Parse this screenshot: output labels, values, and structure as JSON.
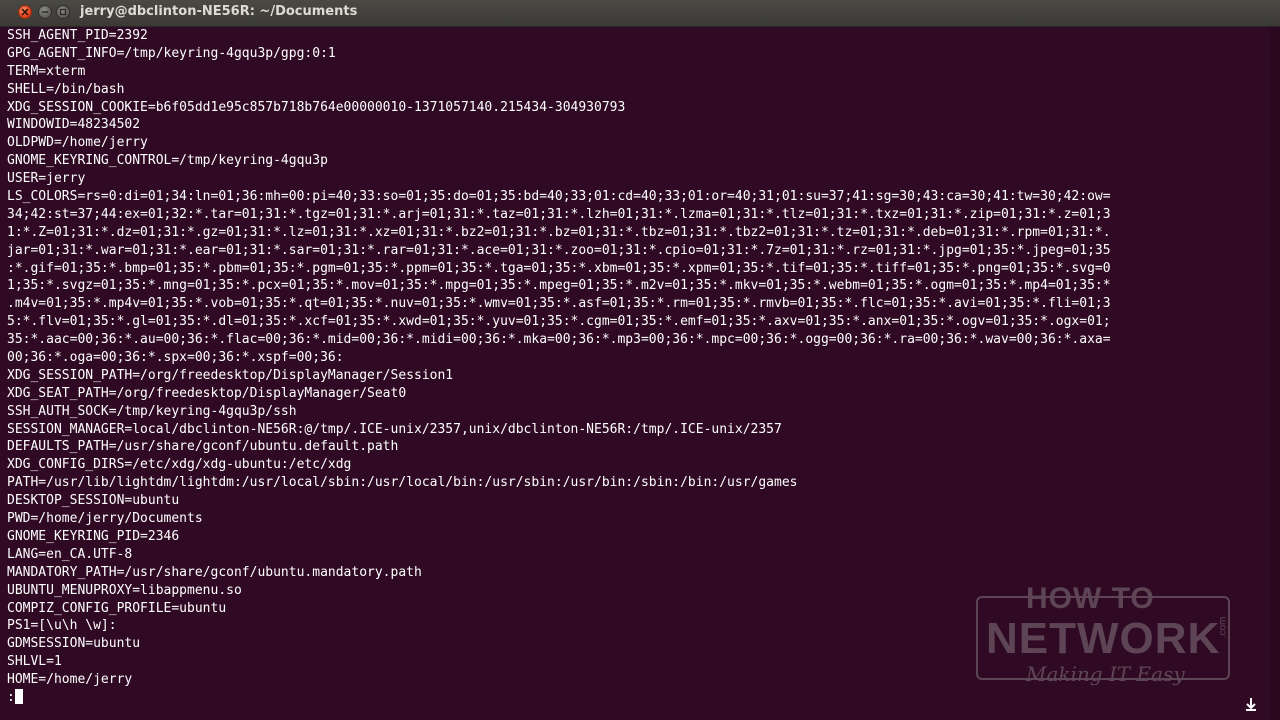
{
  "window": {
    "title": "jerry@dbclinton-NE56R: ~/Documents"
  },
  "terminal": {
    "lines": [
      "SSH_AGENT_PID=2392",
      "GPG_AGENT_INFO=/tmp/keyring-4gqu3p/gpg:0:1",
      "TERM=xterm",
      "SHELL=/bin/bash",
      "XDG_SESSION_COOKIE=b6f05dd1e95c857b718b764e00000010-1371057140.215434-304930793",
      "WINDOWID=48234502",
      "OLDPWD=/home/jerry",
      "GNOME_KEYRING_CONTROL=/tmp/keyring-4gqu3p",
      "USER=jerry",
      "LS_COLORS=rs=0:di=01;34:ln=01;36:mh=00:pi=40;33:so=01;35:do=01;35:bd=40;33;01:cd=40;33;01:or=40;31;01:su=37;41:sg=30;43:ca=30;41:tw=30;42:ow=",
      "34;42:st=37;44:ex=01;32:*.tar=01;31:*.tgz=01;31:*.arj=01;31:*.taz=01;31:*.lzh=01;31:*.lzma=01;31:*.tlz=01;31:*.txz=01;31:*.zip=01;31:*.z=01;3",
      "1:*.Z=01;31:*.dz=01;31:*.gz=01;31:*.lz=01;31:*.xz=01;31:*.bz2=01;31:*.bz=01;31:*.tbz=01;31:*.tbz2=01;31:*.tz=01;31:*.deb=01;31:*.rpm=01;31:*.",
      "jar=01;31:*.war=01;31:*.ear=01;31:*.sar=01;31:*.rar=01;31:*.ace=01;31:*.zoo=01;31:*.cpio=01;31:*.7z=01;31:*.rz=01;31:*.jpg=01;35:*.jpeg=01;35",
      ":*.gif=01;35:*.bmp=01;35:*.pbm=01;35:*.pgm=01;35:*.ppm=01;35:*.tga=01;35:*.xbm=01;35:*.xpm=01;35:*.tif=01;35:*.tiff=01;35:*.png=01;35:*.svg=0",
      "1;35:*.svgz=01;35:*.mng=01;35:*.pcx=01;35:*.mov=01;35:*.mpg=01;35:*.mpeg=01;35:*.m2v=01;35:*.mkv=01;35:*.webm=01;35:*.ogm=01;35:*.mp4=01;35:*",
      ".m4v=01;35:*.mp4v=01;35:*.vob=01;35:*.qt=01;35:*.nuv=01;35:*.wmv=01;35:*.asf=01;35:*.rm=01;35:*.rmvb=01;35:*.flc=01;35:*.avi=01;35:*.fli=01;3",
      "5:*.flv=01;35:*.gl=01;35:*.dl=01;35:*.xcf=01;35:*.xwd=01;35:*.yuv=01;35:*.cgm=01;35:*.emf=01;35:*.axv=01;35:*.anx=01;35:*.ogv=01;35:*.ogx=01;",
      "35:*.aac=00;36:*.au=00;36:*.flac=00;36:*.mid=00;36:*.midi=00;36:*.mka=00;36:*.mp3=00;36:*.mpc=00;36:*.ogg=00;36:*.ra=00;36:*.wav=00;36:*.axa=",
      "00;36:*.oga=00;36:*.spx=00;36:*.xspf=00;36:",
      "XDG_SESSION_PATH=/org/freedesktop/DisplayManager/Session1",
      "XDG_SEAT_PATH=/org/freedesktop/DisplayManager/Seat0",
      "SSH_AUTH_SOCK=/tmp/keyring-4gqu3p/ssh",
      "SESSION_MANAGER=local/dbclinton-NE56R:@/tmp/.ICE-unix/2357,unix/dbclinton-NE56R:/tmp/.ICE-unix/2357",
      "DEFAULTS_PATH=/usr/share/gconf/ubuntu.default.path",
      "XDG_CONFIG_DIRS=/etc/xdg/xdg-ubuntu:/etc/xdg",
      "PATH=/usr/lib/lightdm/lightdm:/usr/local/sbin:/usr/local/bin:/usr/sbin:/usr/bin:/sbin:/bin:/usr/games",
      "DESKTOP_SESSION=ubuntu",
      "PWD=/home/jerry/Documents",
      "GNOME_KEYRING_PID=2346",
      "LANG=en_CA.UTF-8",
      "MANDATORY_PATH=/usr/share/gconf/ubuntu.mandatory.path",
      "UBUNTU_MENUPROXY=libappmenu.so",
      "COMPIZ_CONFIG_PROFILE=ubuntu",
      "PS1=[\\u\\h \\w]:",
      "GDMSESSION=ubuntu",
      "SHLVL=1",
      "HOME=/home/jerry"
    ],
    "pager_prompt": ":"
  },
  "watermark": {
    "line1": "HOW TO",
    "line2": "NETWORK",
    "suffix": ".com",
    "tagline": "Making IT Easy"
  },
  "colors": {
    "background": "#300a24",
    "text": "#ffffff"
  }
}
